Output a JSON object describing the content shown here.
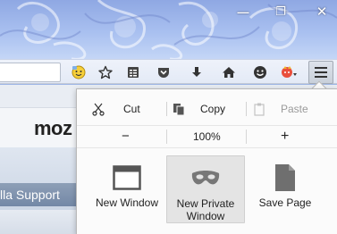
{
  "window_controls": {
    "minimize": "—",
    "maximize": "❐",
    "close": "✕"
  },
  "toolbar": {
    "icons": [
      "hello-icon",
      "bookmark-star-icon",
      "reading-list-icon",
      "pocket-icon",
      "download-icon",
      "home-icon",
      "smiley-icon",
      "extension-icon"
    ]
  },
  "page": {
    "logo_text": "moz",
    "support_tab": "lla Support"
  },
  "menu": {
    "edit": {
      "cut": "Cut",
      "copy": "Copy",
      "paste": "Paste"
    },
    "zoom": {
      "out": "−",
      "level": "100%",
      "in": "+"
    },
    "items": [
      {
        "label_line1": "New Window",
        "label_line2": ""
      },
      {
        "label_line1": "New Private",
        "label_line2": "Window"
      },
      {
        "label_line1": "Save Page",
        "label_line2": ""
      }
    ]
  },
  "colors": {
    "titlebar": "#9fb6e6",
    "panel_bg": "#fbfbfb",
    "hover_bg": "#e4e4e4",
    "support_tab": "#7f93b0"
  }
}
